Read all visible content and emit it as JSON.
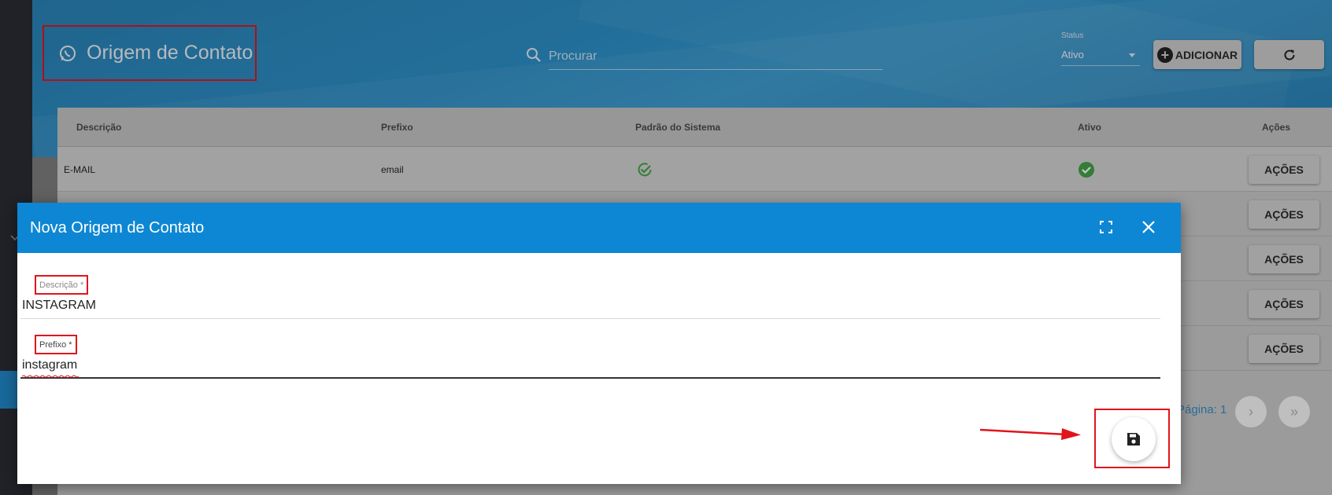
{
  "header": {
    "title": "Origem de Contato",
    "search_placeholder": "Procurar",
    "status_label": "Status",
    "status_value": "Ativo",
    "add_button": "ADICIONAR"
  },
  "table": {
    "columns": [
      "Descrição",
      "Prefixo",
      "Padrão do Sistema",
      "Ativo",
      "Ações"
    ],
    "rows": [
      {
        "descricao": "E-MAIL",
        "prefixo": "email",
        "padrao": true,
        "ativo": true,
        "action": "AÇÕES"
      },
      {
        "action": "AÇÕES"
      },
      {
        "action": "AÇÕES"
      },
      {
        "action": "AÇÕES"
      },
      {
        "action": "AÇÕES"
      }
    ],
    "pagination_label": "Página: 1"
  },
  "modal": {
    "title": "Nova Origem de Contato",
    "fields": [
      {
        "label": "Descrição *",
        "value": "INSTAGRAM"
      },
      {
        "label": "Prefixo *",
        "value": "instagram"
      }
    ]
  },
  "colors": {
    "header_blue": "#2c8fc7",
    "modal_header": "#0d87d3",
    "annotation_red": "#e0151c",
    "check_green": "#43a047"
  },
  "icons": [
    "whatsapp-icon",
    "search-icon",
    "add-circle-icon",
    "refresh-icon",
    "maximize-icon",
    "close-icon",
    "save-icon",
    "check-circle-icon",
    "check-outline-icon",
    "chevron-right-icon",
    "double-chevron-right-icon"
  ]
}
